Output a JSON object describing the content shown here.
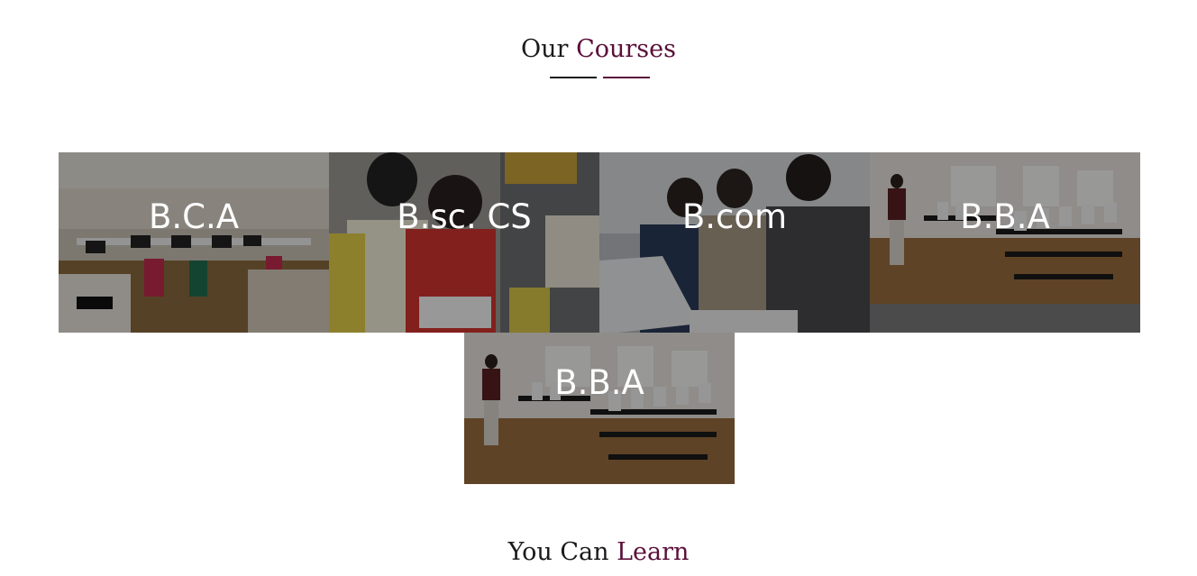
{
  "courses_heading": {
    "prefix": "Our",
    "accent": "Courses"
  },
  "courses": [
    {
      "label": "B.C.A"
    },
    {
      "label": "B.sc. CS"
    },
    {
      "label": "B.com"
    },
    {
      "label": "B.B.A"
    },
    {
      "label": "B.B.A"
    }
  ],
  "learn_heading": {
    "prefix": "You Can",
    "accent": "Learn"
  },
  "colors": {
    "accent": "#5a0f3a",
    "text": "#1a1a1a",
    "background": "#ffffff",
    "overlay_text": "#ffffff"
  }
}
